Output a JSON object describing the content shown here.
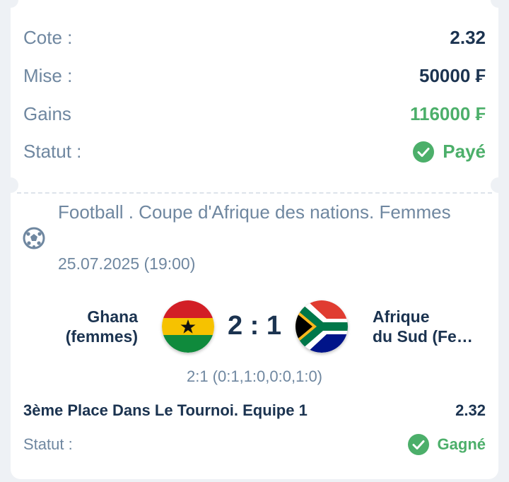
{
  "summary": {
    "odds_label": "Cote :",
    "odds_value": "2.32",
    "stake_label": "Mise :",
    "stake_value": "50000 ₣",
    "winnings_label": "Gains",
    "winnings_value": "116000 ₣",
    "status_label": "Statut :",
    "status_value": "Payé"
  },
  "event": {
    "title": "Football . Coupe d'Afrique des nations. Femmes",
    "datetime": "25.07.2025 (19:00)",
    "sport_icon": "football-icon"
  },
  "match": {
    "home_team_line1": "Ghana",
    "home_team_line2": "(femmes)",
    "away_team_line1": "Afrique",
    "away_team_line2": "du Sud (Fe…",
    "score": "2 : 1",
    "partial_scores": "2:1 (0:1,1:0,0:0,1:0)",
    "home_flag": "ghana-flag-icon",
    "away_flag": "south-africa-flag-icon"
  },
  "bet": {
    "market": "3ème Place Dans Le Tournoi. Equipe 1",
    "odds": "2.32",
    "status_label": "Statut :",
    "status_value": "Gagné"
  },
  "colors": {
    "accent_green": "#4caf6a",
    "label_gray_blue": "#6f87a0",
    "text_dark": "#1b3350"
  }
}
